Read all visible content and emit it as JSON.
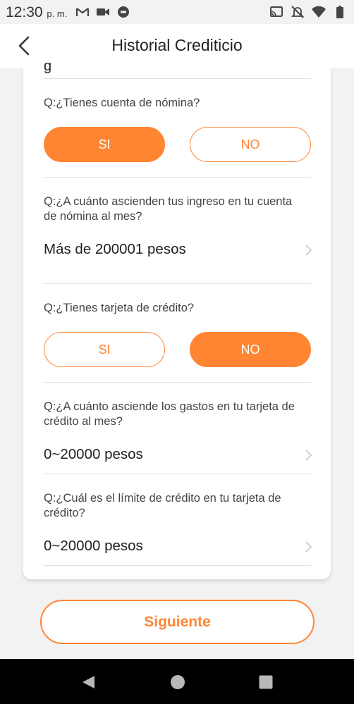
{
  "status_bar": {
    "time": "12:30",
    "ampm": "p. m.",
    "icons": [
      "gmail-icon",
      "video-camera-icon",
      "record-icon",
      "cast-icon",
      "mute-icon",
      "wifi-icon",
      "battery-icon"
    ]
  },
  "header": {
    "title": "Historial Crediticio"
  },
  "form": {
    "partial_top": "g",
    "q1": {
      "label": "Q:¿Tienes cuenta de nómina?",
      "yes": "SI",
      "no": "NO",
      "selected": "yes"
    },
    "q2": {
      "label": "Q:¿A cuánto ascienden tus ingreso en tu cuenta de nómina al mes?",
      "value": "Más de 200001 pesos"
    },
    "q3": {
      "label": "Q:¿Tienes tarjeta de crédito?",
      "yes": "SI",
      "no": "NO",
      "selected": "no"
    },
    "q4": {
      "label": "Q:¿A cuánto asciende los gastos en tu tarjeta de crédito al mes?",
      "value": "0~20000 pesos"
    },
    "q5": {
      "label": "Q:¿Cuál es el límite de crédito en tu tarjeta de crédito?",
      "value": "0~20000 pesos"
    }
  },
  "next_label": "Siguiente",
  "colors": {
    "accent": "#ff8533",
    "background": "#f2f2f2",
    "card": "#ffffff"
  }
}
